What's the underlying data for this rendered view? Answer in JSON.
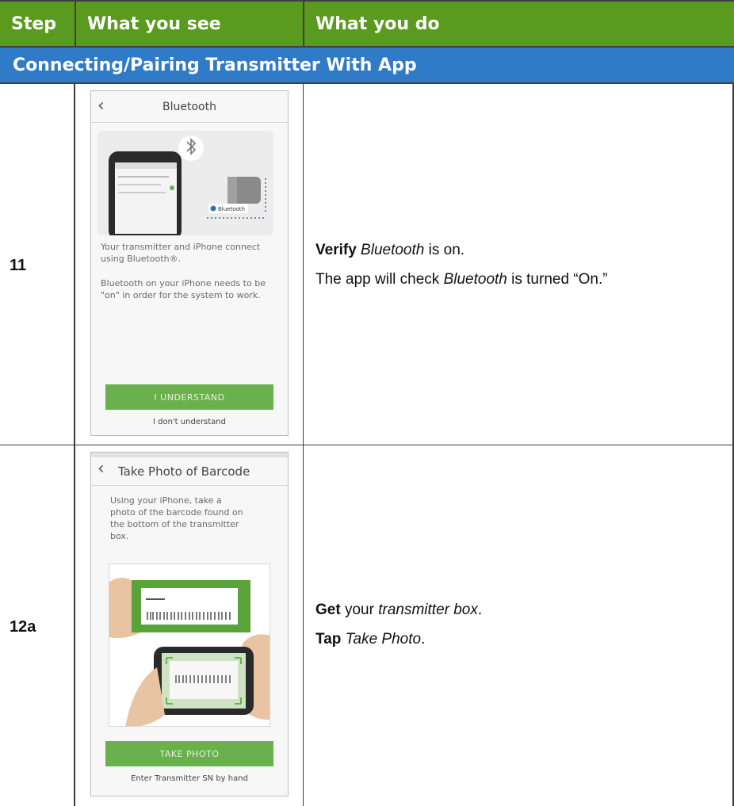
{
  "header": {
    "col_step": "Step",
    "col_see": "What you see",
    "col_do": "What you do"
  },
  "section": {
    "title": "Connecting/Pairing Transmitter With App"
  },
  "rows": [
    {
      "step": "11",
      "phone": {
        "title": "Bluetooth",
        "badge": "Bluetooth",
        "text1": "Your transmitter and iPhone connect using Bluetooth®.",
        "text2": "Bluetooth on your iPhone needs to be \"on\" in order for the system to work.",
        "button": "I UNDERSTAND",
        "link": "I don't understand"
      },
      "instructions": {
        "l1_bold": "Verify",
        "l1_italic": "Bluetooth",
        "l1_rest": " is on.",
        "l2_pre": "The app will check ",
        "l2_italic": "Bluetooth",
        "l2_rest": " is turned “On.”"
      }
    },
    {
      "step": "12a",
      "phone": {
        "title": "Take Photo of Barcode",
        "text1": "Using your iPhone, take a photo of the barcode found on the bottom of the transmitter box.",
        "button": "TAKE PHOTO",
        "link": "Enter Transmitter SN by hand"
      },
      "instructions": {
        "l1_bold": "Get",
        "l1_pre": " your ",
        "l1_italic": "transmitter box",
        "l1_rest": ".",
        "l2_bold": "Tap",
        "l2_italic": "Take Photo",
        "l2_rest": "."
      }
    }
  ],
  "colors": {
    "header_green": "#5a9a1f",
    "section_blue": "#2f7bc8",
    "button_green": "#6ab04c"
  },
  "icons": [
    "back-chevron-icon",
    "bluetooth-icon"
  ]
}
